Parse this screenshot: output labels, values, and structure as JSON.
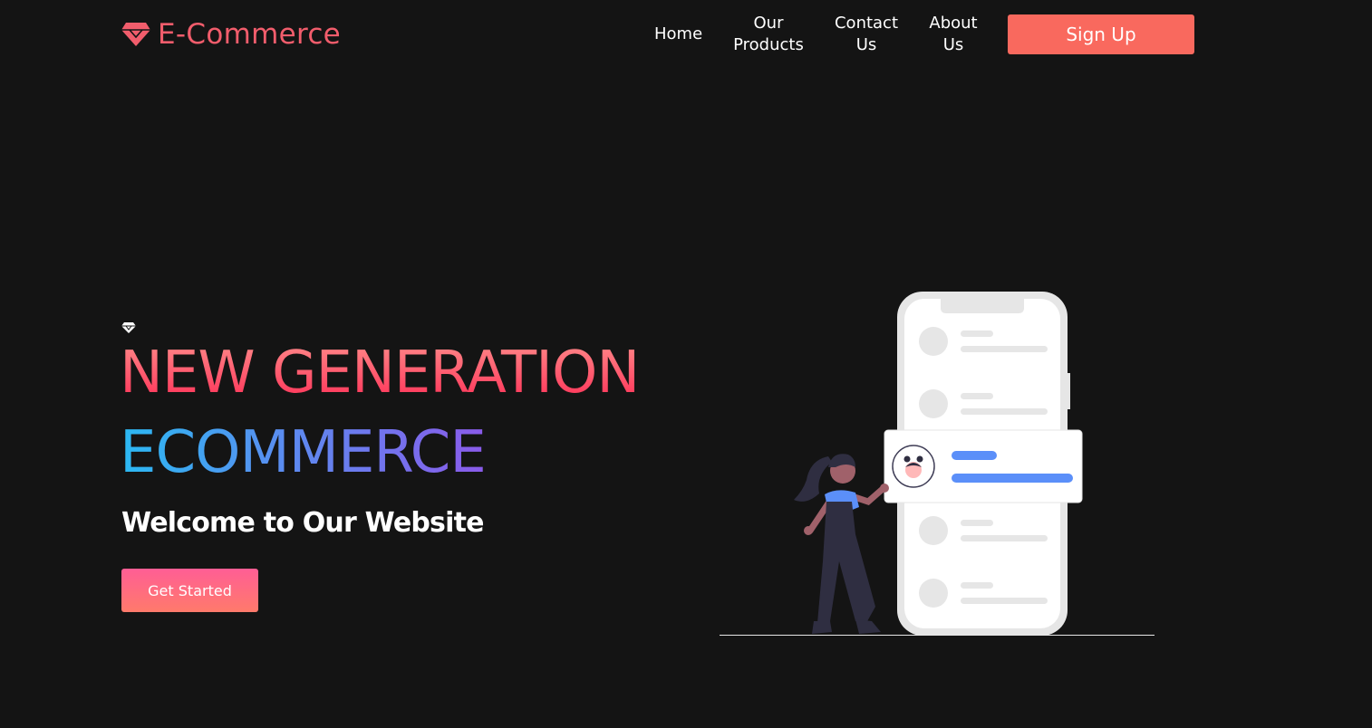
{
  "header": {
    "logo_text": "E-Commerce",
    "nav": {
      "home": "Home",
      "products_line1": "Our",
      "products_line2": "Products",
      "contact_line1": "Contact",
      "contact_line2": "Us",
      "about_line1": "About",
      "about_line2": "Us"
    },
    "signup_label": "Sign Up"
  },
  "hero": {
    "headline_line1": "NEW GENERATION",
    "headline_line2": "ECOMMERCE",
    "subtitle": "Welcome to Our Website",
    "cta_label": "Get Started"
  },
  "colors": {
    "background": "#141414",
    "brand": "#f25d6c",
    "signup": "#f9695e",
    "accent_blue": "#5b8ff9"
  },
  "icons": {
    "logo": "diamond-icon",
    "hero_badge": "diamond-icon"
  }
}
